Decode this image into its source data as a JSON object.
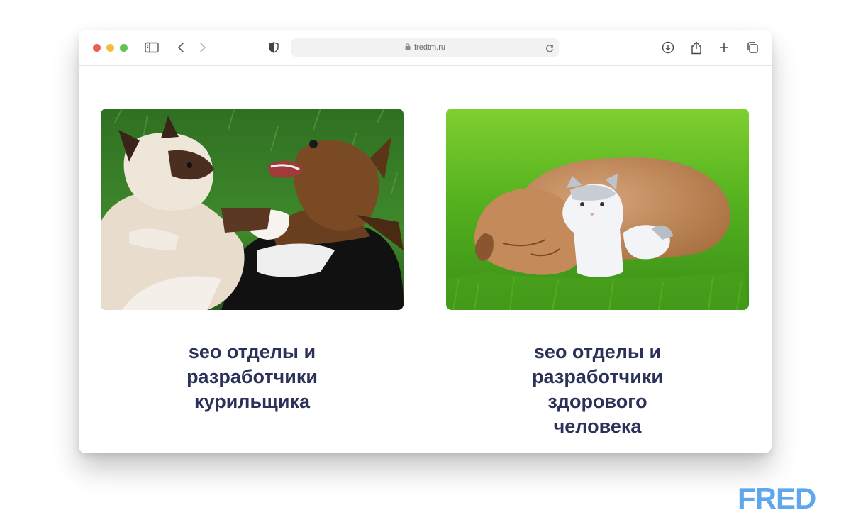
{
  "browser": {
    "url": "fredtm.ru",
    "icons": {
      "sidebar": "sidebar-icon",
      "back": "chevron-left-icon",
      "forward": "chevron-right-icon",
      "privacy": "shield-icon",
      "lock": "lock-icon",
      "reload": "reload-icon",
      "download": "download-icon",
      "share": "share-icon",
      "new_tab": "plus-icon",
      "tabs": "tabs-overview-icon"
    }
  },
  "cards": [
    {
      "image": "cat and puppy fighting on grass",
      "caption_lines": [
        "seo отделы и",
        "разработчики",
        "курильщика"
      ]
    },
    {
      "image": "puppy and kitten cuddling on grass",
      "caption_lines": [
        "seo отделы и",
        "разработчики",
        "здорового",
        "человека"
      ]
    }
  ],
  "brand": {
    "logo_text": "FRED",
    "color_primary": "#5ea7ef",
    "color_caption": "#2b3158"
  }
}
